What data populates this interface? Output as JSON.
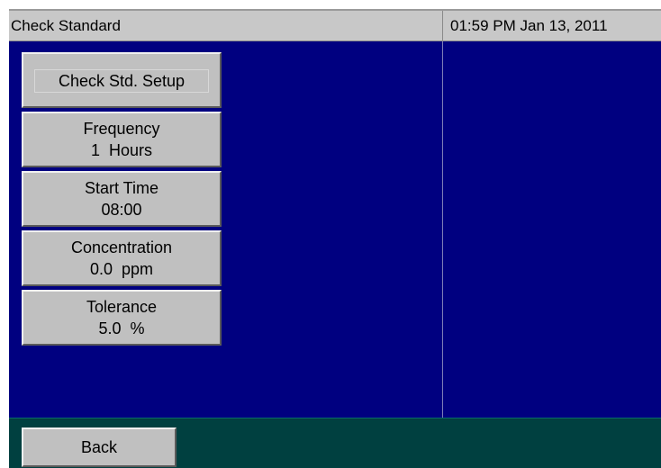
{
  "header": {
    "title": "Check Standard",
    "datetime": "01:59 PM Jan 13, 2011"
  },
  "setup_button": {
    "label": "Check Std. Setup"
  },
  "params": [
    {
      "name": "Frequency",
      "value": "1  Hours"
    },
    {
      "name": "Start Time",
      "value": "08:00"
    },
    {
      "name": "Concentration",
      "value": "0.0  ppm"
    },
    {
      "name": "Tolerance",
      "value": "5.0  %"
    }
  ],
  "footer": {
    "back_label": "Back"
  },
  "colors": {
    "main_panel": "#000080",
    "footer_bar": "#004040",
    "title_bar": "#c8c8c8",
    "button_face": "#c0c0c0"
  }
}
